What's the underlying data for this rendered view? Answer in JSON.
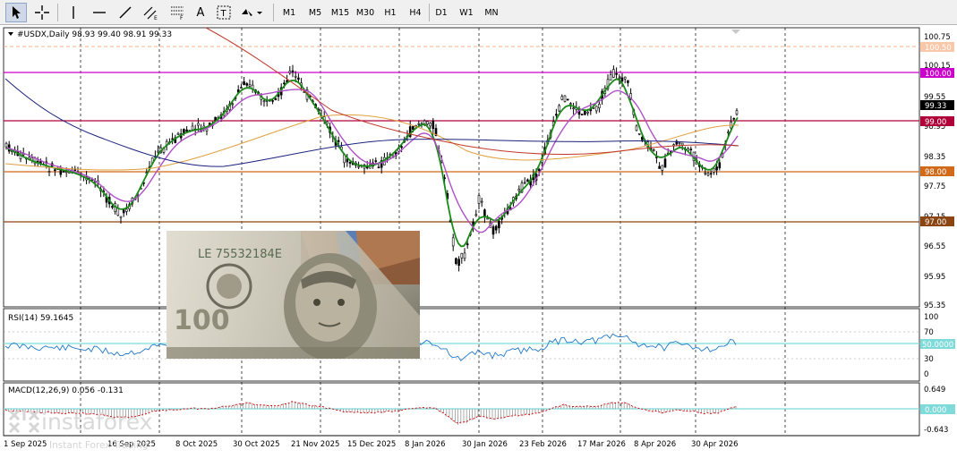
{
  "toolbar": {
    "tools": [
      {
        "icon": "cursor-arrow-icon"
      },
      {
        "icon": "crosshair-icon"
      },
      {
        "icon": "vertical-line-icon"
      },
      {
        "icon": "horizontal-line-icon"
      },
      {
        "icon": "trendline-icon"
      },
      {
        "icon": "equidistant-channel-icon"
      },
      {
        "icon": "fibonacci-retracement-icon"
      },
      {
        "icon": "text-label-icon"
      },
      {
        "icon": "text-box-icon"
      },
      {
        "icon": "arrows-shapes-icon"
      }
    ],
    "timeframes": [
      "M1",
      "M5",
      "M15",
      "M30",
      "H1",
      "H4",
      "D1",
      "W1",
      "MN"
    ]
  },
  "chart": {
    "header": "#USDX,Daily  98.93 99.40 98.91 99.33",
    "price_labels": [
      "100.75",
      "100.15",
      "99.55",
      "98.95",
      "98.35",
      "97.75",
      "97.15",
      "96.55",
      "95.95",
      "95.35"
    ],
    "level_tags": [
      {
        "text": "100.50",
        "color": "#f4b183",
        "kind": "dashed-orange"
      },
      {
        "text": "100.00",
        "color": "#cc00cc",
        "kind": "magenta"
      },
      {
        "text": "99.33",
        "color": "#000000",
        "kind": "current-price"
      },
      {
        "text": "99.00",
        "color": "#b0003a",
        "kind": "crimson"
      },
      {
        "text": "98.00",
        "color": "#d06a1a",
        "kind": "orange"
      },
      {
        "text": "97.00",
        "color": "#8b4513",
        "kind": "brown"
      }
    ],
    "date_labels": [
      "1 Sep 2025",
      "16 Sep 2025",
      "8 Oct 2025",
      "30 Oct 2025",
      "21 Nov 2025",
      "15 Dec 2025",
      "8 Jan 2026",
      "30 Jan 2026",
      "23 Feb 2026",
      "17 Mar 2026",
      "8 Apr 2026",
      "30 Apr 2026"
    ]
  },
  "rsi": {
    "header": "RSI(14) 59.1645",
    "scale": [
      "100",
      "70",
      "50.0000",
      "30",
      "0"
    ]
  },
  "macd": {
    "header": "MACD(12,26,9) 0.056 -0.131",
    "scale": [
      "0.649",
      "0.000",
      "-0.643"
    ]
  },
  "branding": {
    "logo": "instaforex",
    "tagline": "Instant Forex Trading"
  },
  "colors": {
    "ma_fast": "#1a8a1a",
    "ma_mid": "#b04fc8",
    "ma_slow_orange": "#e0a040",
    "ma_slow_navy": "#1a237e",
    "ma_red": "#c0392b",
    "rsi_line": "#1f78c8",
    "level_cyan": "#7fdada"
  }
}
